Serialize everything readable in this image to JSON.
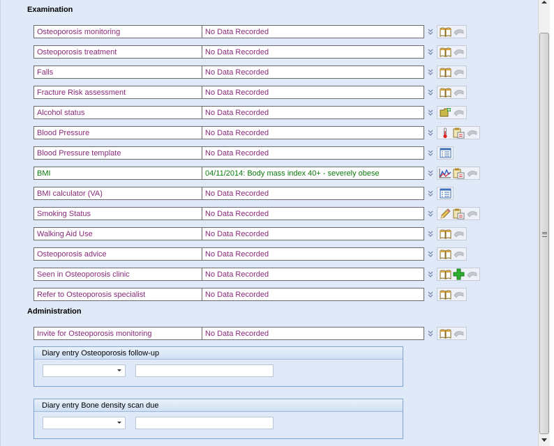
{
  "sections": {
    "examination": "Examination",
    "administration": "Administration"
  },
  "rows": [
    {
      "label": "Osteoporosis monitoring",
      "value": "No Data Recorded",
      "icons": [
        "book-icon",
        "undo-icon"
      ]
    },
    {
      "label": "Osteoporosis treatment",
      "value": "No Data Recorded",
      "icons": [
        "book-icon",
        "undo-icon"
      ]
    },
    {
      "label": "Falls",
      "value": "No Data Recorded",
      "icons": [
        "book-icon",
        "undo-icon"
      ]
    },
    {
      "label": "Fracture Risk assessment",
      "value": "No Data Recorded",
      "icons": [
        "book-icon",
        "undo-icon"
      ]
    },
    {
      "label": "Alcohol status",
      "value": "No Data Recorded",
      "icons": [
        "add-folder-icon",
        "undo-icon"
      ]
    },
    {
      "label": "Blood Pressure",
      "value": "No Data Recorded",
      "icons": [
        "thermometer-icon",
        "clipboard-icon",
        "undo-icon"
      ]
    },
    {
      "label": "Blood Pressure template",
      "value": "No Data Recorded",
      "icons": [
        "template-list-icon"
      ]
    },
    {
      "label": "BMI",
      "value": "04/11/2014: Body mass index 40+ - severely obese",
      "icons": [
        "graph-icon",
        "clipboard-icon",
        "undo-icon"
      ],
      "status_color": "#0a7a0a"
    },
    {
      "label": "BMI calculator (VA)",
      "value": "No Data Recorded",
      "icons": [
        "template-list-icon"
      ]
    },
    {
      "label": "Smoking Status",
      "value": "No Data Recorded",
      "icons": [
        "pencil-icon",
        "clipboard-icon",
        "undo-icon"
      ]
    },
    {
      "label": "Walking Aid Use",
      "value": "No Data Recorded",
      "icons": [
        "book-icon",
        "undo-icon"
      ]
    },
    {
      "label": "Osteoporosis advice",
      "value": "No Data Recorded",
      "icons": [
        "book-icon",
        "undo-icon"
      ]
    },
    {
      "label": "Seen in Osteoporosis clinic",
      "value": "No Data Recorded",
      "icons": [
        "book-icon",
        "plus-icon",
        "undo-icon"
      ]
    },
    {
      "label": "Refer to Osteoporosis specialist",
      "value": "No Data Recorded",
      "icons": [
        "book-icon",
        "undo-icon"
      ]
    }
  ],
  "admin_rows": [
    {
      "label": "Invite for Osteoporosis monitoring",
      "value": "No Data Recorded",
      "icons": [
        "book-icon",
        "undo-icon"
      ]
    }
  ],
  "diary": [
    {
      "title": "Diary entry Osteoporosis follow-up",
      "combo_value": "",
      "text_value": ""
    },
    {
      "title": "Diary entry Bone density scan due",
      "combo_value": "",
      "text_value": ""
    }
  ],
  "colors": {
    "label": "#8a2a7a",
    "recorded": "#0a7a0a",
    "pane_bg": "#dfe9f7"
  }
}
